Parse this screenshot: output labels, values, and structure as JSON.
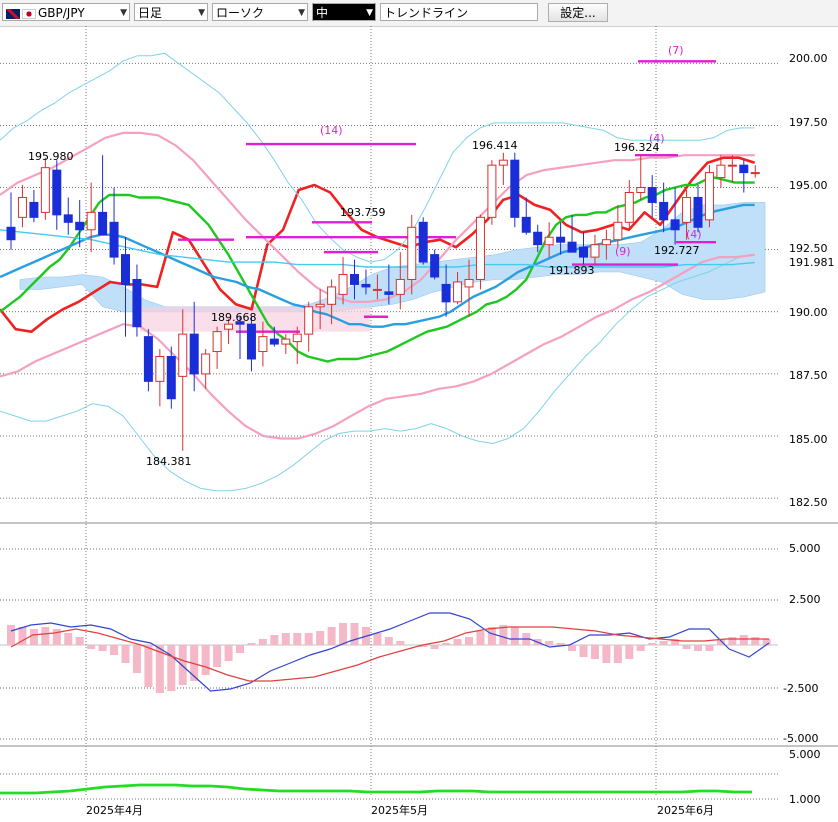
{
  "toolbar": {
    "symbol": "GBP/JPY",
    "period": "日足",
    "chart_style": "ローソク",
    "size": "中",
    "tool": "トレンドライン",
    "settings": "設定..."
  },
  "colors": {
    "bull": "#d93030",
    "bear": "#1a2ed8",
    "sma_short": "#1ec81e",
    "sma_long": "#2a9fe0",
    "sma_xlong": "#44ccee",
    "bb_inner": "#f5a0c0",
    "bb_outer": "#7fd3ea",
    "cloud": "#bfe0f8",
    "trend": "#ee2222",
    "sr": "#e020d0",
    "macd": "#3344cc",
    "signal": "#e04040",
    "hist": "#f4b8c8",
    "bottom": "#22dd22"
  },
  "chart_data": [
    {
      "type": "candlestick",
      "x_labels": [
        "2025年4月",
        "2025年5月",
        "2025年6月"
      ],
      "ylim": [
        181.5,
        201.5
      ],
      "y_ticks": [
        "200.00",
        "197.50",
        "195.00",
        "192.50",
        "191.981",
        "190.00",
        "187.50",
        "185.00",
        "182.50"
      ],
      "candles": [
        [
          193.4,
          194.8,
          192.5,
          192.9
        ],
        [
          193.8,
          195.1,
          193.4,
          194.6
        ],
        [
          194.4,
          194.9,
          193.6,
          193.8
        ],
        [
          194.0,
          196.2,
          193.7,
          195.8
        ],
        [
          195.7,
          196.1,
          193.3,
          193.9
        ],
        [
          193.9,
          194.6,
          193.1,
          193.6
        ],
        [
          193.6,
          194.5,
          192.6,
          193.3
        ],
        [
          193.3,
          195.2,
          192.4,
          194.0
        ],
        [
          194.0,
          196.3,
          193.3,
          193.1
        ],
        [
          193.6,
          195.0,
          191.9,
          192.2
        ],
        [
          192.3,
          193.0,
          189.0,
          191.1
        ],
        [
          191.3,
          191.9,
          189.0,
          189.4
        ],
        [
          189.0,
          189.3,
          186.8,
          187.2
        ],
        [
          187.2,
          188.5,
          186.2,
          188.2
        ],
        [
          188.2,
          188.6,
          186.1,
          186.5
        ],
        [
          187.4,
          190.1,
          184.4,
          189.1
        ],
        [
          189.1,
          190.4,
          186.8,
          187.5
        ],
        [
          187.5,
          188.5,
          186.9,
          188.3
        ],
        [
          188.4,
          189.4,
          187.7,
          189.2
        ],
        [
          189.3,
          189.7,
          188.7,
          189.5
        ],
        [
          189.6,
          189.8,
          188.1,
          189.5
        ],
        [
          189.5,
          189.8,
          187.6,
          188.1
        ],
        [
          188.4,
          189.6,
          187.8,
          189.0
        ],
        [
          188.9,
          189.4,
          188.6,
          188.7
        ],
        [
          188.7,
          189.1,
          188.3,
          188.9
        ],
        [
          188.8,
          189.4,
          187.9,
          189.1
        ],
        [
          189.1,
          190.4,
          188.4,
          190.2
        ],
        [
          190.2,
          190.9,
          189.3,
          190.3
        ],
        [
          190.3,
          191.3,
          189.5,
          191.0
        ],
        [
          190.7,
          192.2,
          190.3,
          191.5
        ],
        [
          191.5,
          192.1,
          190.5,
          191.1
        ],
        [
          191.1,
          191.7,
          190.7,
          191.0
        ],
        [
          190.9,
          191.5,
          190.5,
          190.9
        ],
        [
          190.8,
          191.9,
          190.3,
          190.7
        ],
        [
          190.7,
          192.4,
          190.1,
          191.3
        ],
        [
          191.3,
          193.9,
          190.7,
          193.4
        ],
        [
          193.6,
          193.8,
          191.9,
          192.0
        ],
        [
          192.3,
          192.5,
          191.3,
          191.4
        ],
        [
          191.1,
          191.9,
          189.8,
          190.4
        ],
        [
          190.4,
          191.6,
          190.3,
          191.2
        ],
        [
          191.0,
          192.1,
          189.8,
          191.3
        ],
        [
          191.3,
          193.9,
          190.9,
          193.8
        ],
        [
          193.8,
          196.1,
          193.5,
          195.9
        ],
        [
          195.9,
          196.4,
          195.1,
          196.1
        ],
        [
          196.1,
          196.4,
          193.4,
          193.8
        ],
        [
          193.8,
          194.6,
          193.1,
          193.2
        ],
        [
          193.2,
          193.5,
          192.4,
          192.7
        ],
        [
          192.7,
          193.6,
          192.2,
          193.0
        ],
        [
          193.0,
          193.6,
          192.3,
          192.8
        ],
        [
          192.8,
          193.9,
          192.5,
          192.4
        ],
        [
          192.6,
          193.2,
          191.9,
          192.2
        ],
        [
          192.2,
          193.1,
          191.9,
          192.7
        ],
        [
          192.7,
          193.3,
          192.1,
          192.9
        ],
        [
          192.9,
          194.3,
          192.6,
          193.6
        ],
        [
          193.6,
          195.3,
          193.3,
          194.8
        ],
        [
          194.8,
          196.3,
          194.5,
          195.0
        ],
        [
          195.0,
          195.5,
          193.8,
          194.4
        ],
        [
          194.4,
          195.2,
          193.2,
          193.7
        ],
        [
          193.7,
          195.0,
          192.7,
          193.3
        ],
        [
          193.6,
          194.9,
          192.9,
          194.6
        ],
        [
          194.6,
          195.1,
          193.2,
          193.4
        ],
        [
          193.7,
          195.9,
          193.4,
          195.6
        ],
        [
          195.4,
          196.3,
          195.0,
          195.9
        ],
        [
          195.9,
          196.3,
          195.2,
          195.9
        ],
        [
          195.9,
          196.1,
          194.8,
          195.6
        ],
        [
          195.6,
          195.9,
          195.4,
          195.6
        ]
      ],
      "series": [
        {
          "color_key": "trend",
          "values": [
            190.1,
            189.3,
            189.2,
            189.7,
            190.1,
            190.4,
            190.8,
            191.2,
            191.1,
            191.1,
            191.0,
            193.2,
            192.9,
            191.9,
            190.9,
            190.3,
            190.1,
            192.7,
            193.3,
            194.9,
            195.1,
            194.8,
            194.0,
            193.3,
            193.0,
            192.8,
            192.6,
            192.8,
            192.9,
            192.6,
            193.1,
            193.7,
            194.5,
            194.7,
            194.3,
            194.1,
            193.5,
            193.2,
            193.3,
            193.5,
            193.3,
            194.0,
            193.5,
            194.4,
            195.3,
            196.0,
            196.2,
            196.2,
            196.0
          ]
        },
        {
          "color_key": "sma_short",
          "values": [
            190.0,
            190.3,
            190.6,
            191.0,
            191.4,
            191.8,
            192.1,
            192.6,
            193.2,
            193.8,
            194.4,
            194.7,
            194.7,
            194.7,
            194.6,
            194.6,
            194.6,
            194.5,
            194.4,
            194.3,
            193.9,
            193.5,
            192.9,
            192.3,
            191.6,
            190.9,
            190.2,
            189.5,
            189.1,
            188.8,
            188.4,
            188.2,
            188.1,
            188.0,
            188.1,
            188.1,
            188.1,
            188.2,
            188.3,
            188.4,
            188.6,
            188.8,
            189.0,
            189.2,
            189.3,
            189.4,
            189.6,
            189.8,
            190.0,
            190.3,
            190.4,
            190.6,
            190.9,
            191.3,
            192.1,
            192.9,
            193.5,
            193.8,
            193.9,
            193.9,
            194.0,
            194.0,
            194.2,
            194.3,
            194.4,
            194.6,
            194.7,
            194.9,
            195.0,
            195.1,
            195.1,
            195.3,
            195.4,
            195.3,
            195.2,
            195.2,
            195.2
          ]
        },
        {
          "color_key": "sma_long",
          "values": [
            191.4,
            191.6,
            191.8,
            192.0,
            192.2,
            192.4,
            192.6,
            192.8,
            193.0,
            193.1,
            193.1,
            193.0,
            192.8,
            192.6,
            192.4,
            192.2,
            192.0,
            191.8,
            191.6,
            191.4,
            191.3,
            191.2,
            191.0,
            190.9,
            190.7,
            190.5,
            190.3,
            190.2,
            190.0,
            189.9,
            189.7,
            189.5,
            189.5,
            189.4,
            189.4,
            189.5,
            189.5,
            189.6,
            189.7,
            189.8,
            190.0,
            190.3,
            190.6,
            190.8,
            191.0,
            191.3,
            191.6,
            191.8,
            192.0,
            192.2,
            192.4,
            192.5,
            192.6,
            192.7,
            192.8,
            192.9,
            193.0,
            193.1,
            193.2,
            193.3,
            193.4,
            193.6,
            193.8,
            194.0,
            194.1,
            194.2,
            194.3,
            194.3
          ]
        },
        {
          "color_key": "bb_outer",
          "values": [
            196.9,
            197.4,
            197.7,
            198.1,
            198.4,
            198.8,
            199.1,
            199.4,
            199.7,
            200.1,
            200.3,
            200.3,
            200.4,
            200.0,
            199.6,
            199.2,
            198.8,
            198.2,
            197.6,
            196.9,
            196.1,
            195.2,
            194.5,
            193.6,
            193.0,
            192.5,
            192.2,
            192.0,
            192.1,
            192.5,
            193.2,
            194.2,
            195.3,
            196.4,
            197.0,
            197.4,
            197.6,
            197.6,
            197.6,
            197.6,
            197.6,
            197.6,
            197.5,
            197.4,
            197.3,
            197.0,
            196.9,
            196.9,
            196.9,
            196.9,
            196.9,
            196.9,
            197.0,
            197.3,
            197.4,
            197.4
          ]
        },
        {
          "color_key": "bb_outer",
          "values": [
            186.0,
            185.8,
            185.6,
            185.6,
            185.8,
            186.0,
            186.3,
            186.2,
            185.8,
            185.0,
            184.2,
            183.6,
            183.2,
            182.9,
            182.8,
            182.8,
            182.9,
            183.1,
            183.4,
            183.8,
            184.3,
            184.8,
            185.1,
            185.2,
            185.2,
            185.3,
            185.2,
            185.3,
            185.5,
            185.3,
            185.0,
            184.8,
            184.7,
            184.9,
            185.3,
            186.0,
            186.8,
            187.5,
            188.2,
            188.8,
            189.5,
            190.1,
            190.6,
            190.9,
            191.2,
            191.4,
            191.6,
            191.9,
            192.2,
            192.3
          ]
        },
        {
          "color_key": "bb_inner",
          "values": [
            194.7,
            195.2,
            195.5,
            195.8,
            196.2,
            196.6,
            197.0,
            197.2,
            197.2,
            197.1,
            196.7,
            196.1,
            195.3,
            194.5,
            193.7,
            193.0,
            192.3,
            191.6,
            191.0,
            190.6,
            190.4,
            190.4,
            190.5,
            190.8,
            191.3,
            192.1,
            192.9,
            193.6,
            194.3,
            195.0,
            195.5,
            195.7,
            195.8,
            195.9,
            196.0,
            196.1,
            196.1,
            196.2,
            196.2,
            196.3,
            196.3,
            196.3,
            196.3,
            196.3
          ]
        },
        {
          "color_key": "bb_inner",
          "values": [
            187.4,
            187.6,
            188.0,
            188.3,
            188.6,
            188.9,
            189.2,
            189.5,
            189.4,
            188.9,
            188.2,
            187.5,
            186.7,
            186.0,
            185.4,
            185.0,
            184.9,
            184.9,
            185.1,
            185.4,
            185.8,
            186.2,
            186.5,
            186.6,
            186.7,
            186.9,
            187.0,
            187.2,
            187.5,
            187.9,
            188.3,
            188.7,
            189.0,
            189.4,
            189.8,
            190.1,
            190.5,
            190.8,
            191.2,
            191.6,
            192.0,
            192.2,
            192.2,
            192.3
          ]
        }
      ],
      "annotations": [
        "195.980",
        "184.381",
        "189.668",
        "193.759",
        "196.414",
        "196.324",
        "191.893",
        "192.727",
        "(14)",
        "(7)",
        "(4)",
        "(9)",
        "(4)"
      ]
    },
    {
      "type": "line",
      "y_ticks": [
        "5.000",
        "2.500",
        "-2.500",
        "-5.000"
      ],
      "ylim": [
        -6.0,
        6.0
      ]
    },
    {
      "type": "line",
      "y_ticks": [
        "1.000"
      ]
    }
  ]
}
